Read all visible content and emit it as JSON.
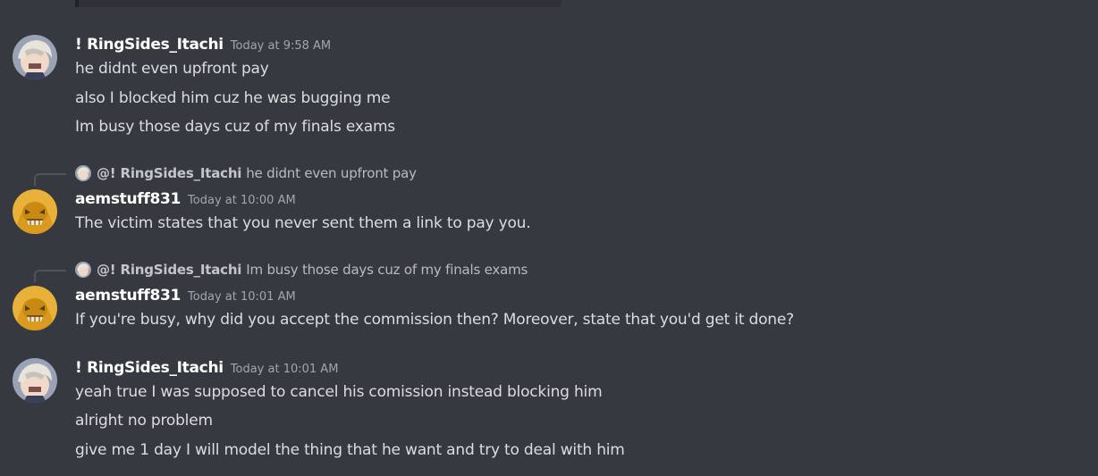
{
  "messages": [
    {
      "username": "! RingSides_Itachi",
      "timestamp": "Today at 9:58 AM",
      "avatar": "anime-avatar-icon",
      "lines": [
        "he didnt even upfront pay",
        "also I blocked him cuz he was bugging me",
        "Im busy those days cuz of my finals exams"
      ]
    },
    {
      "reply": {
        "name": "@! RingSides_Itachi",
        "text": "he didnt even upfront pay"
      },
      "username": "aemstuff831",
      "timestamp": "Today at 10:00 AM",
      "avatar": "yellow-character-avatar-icon",
      "lines": [
        "The victim states that you never sent them a link to pay you."
      ]
    },
    {
      "reply": {
        "name": "@! RingSides_Itachi",
        "text": "Im busy those days cuz of my finals exams"
      },
      "username": "aemstuff831",
      "timestamp": "Today at 10:01 AM",
      "avatar": "yellow-character-avatar-icon",
      "lines": [
        "If you're busy, why did you accept the commission then? Moreover, state that you'd get it done?"
      ]
    },
    {
      "username": "! RingSides_Itachi",
      "timestamp": "Today at 10:01 AM",
      "avatar": "anime-avatar-icon",
      "lines": [
        "yeah true I was supposed to cancel his comission instead blocking him",
        "alright no problem",
        "give me 1 day I will model the thing that he want and try to deal with him"
      ]
    }
  ],
  "colors": {
    "background": "#36393f",
    "username": "#ffffff",
    "text": "#dcddde",
    "timestamp": "#a3a6aa",
    "reply_text": "#b9bbbe"
  }
}
